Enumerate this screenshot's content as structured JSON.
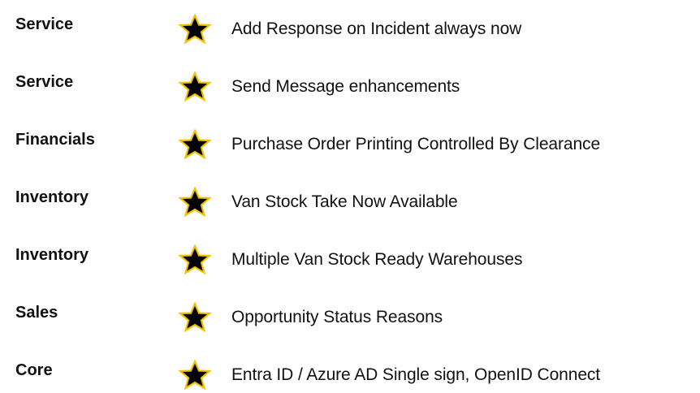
{
  "star_colors": {
    "fill": "#000000",
    "outline": "#f2c200"
  },
  "items": [
    {
      "category": "Service",
      "feature": "Add Response on Incident always now",
      "icon": "star-icon"
    },
    {
      "category": "Service",
      "feature": "Send Message enhancements",
      "icon": "star-icon"
    },
    {
      "category": "Financials",
      "feature": "Purchase Order Printing Controlled By Clearance",
      "icon": "star-icon"
    },
    {
      "category": "Inventory",
      "feature": "Van Stock Take Now Available",
      "icon": "star-icon"
    },
    {
      "category": "Inventory",
      "feature": "Multiple Van Stock Ready Warehouses",
      "icon": "star-icon"
    },
    {
      "category": "Sales",
      "feature": "Opportunity Status Reasons",
      "icon": "star-icon"
    },
    {
      "category": "Core",
      "feature": "Entra ID / Azure AD Single sign, OpenID Connect",
      "icon": "star-icon"
    }
  ]
}
